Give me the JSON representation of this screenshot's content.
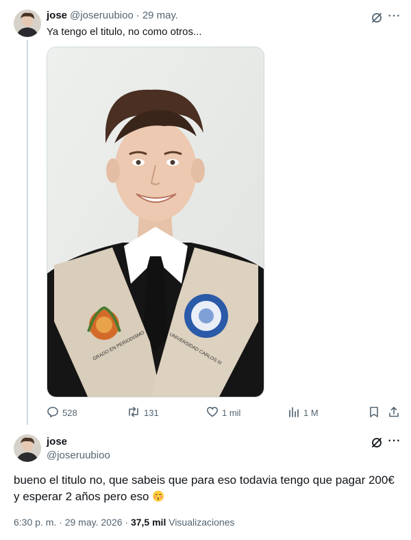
{
  "tweet1": {
    "display_name": "jose",
    "handle": "@joseruubioo",
    "separator": "·",
    "date": "29 may.",
    "text": "Ya tengo el titulo, no como otros...",
    "more_label": "···",
    "media": {
      "stole_left_text": "GRADO EN PERIODISMO",
      "stole_right_text": "UNIVERSIDAD CARLOS III",
      "seal_text": "UNIVERSIDAD CARLOS III DE MADRID"
    },
    "actions": {
      "replies": "528",
      "reposts": "131",
      "likes": "1 mil",
      "views": "1 M"
    }
  },
  "tweet2": {
    "display_name": "jose",
    "handle": "@joseruubioo",
    "more_label": "···",
    "text": "bueno el titulo no, que sabeis que para eso todavia tengo que pagar 200€ y esperar 2 años pero eso",
    "emoji": "kissing-face-emoji",
    "time": "6:30 p. m.",
    "dot1": "·",
    "date": "29 may. 2026",
    "dot2": "·",
    "views_count": "37,5 mil",
    "views_label": "Visualizaciones"
  },
  "colors": {
    "text": "#0f1419",
    "muted": "#536471",
    "line": "#cfd9de"
  }
}
